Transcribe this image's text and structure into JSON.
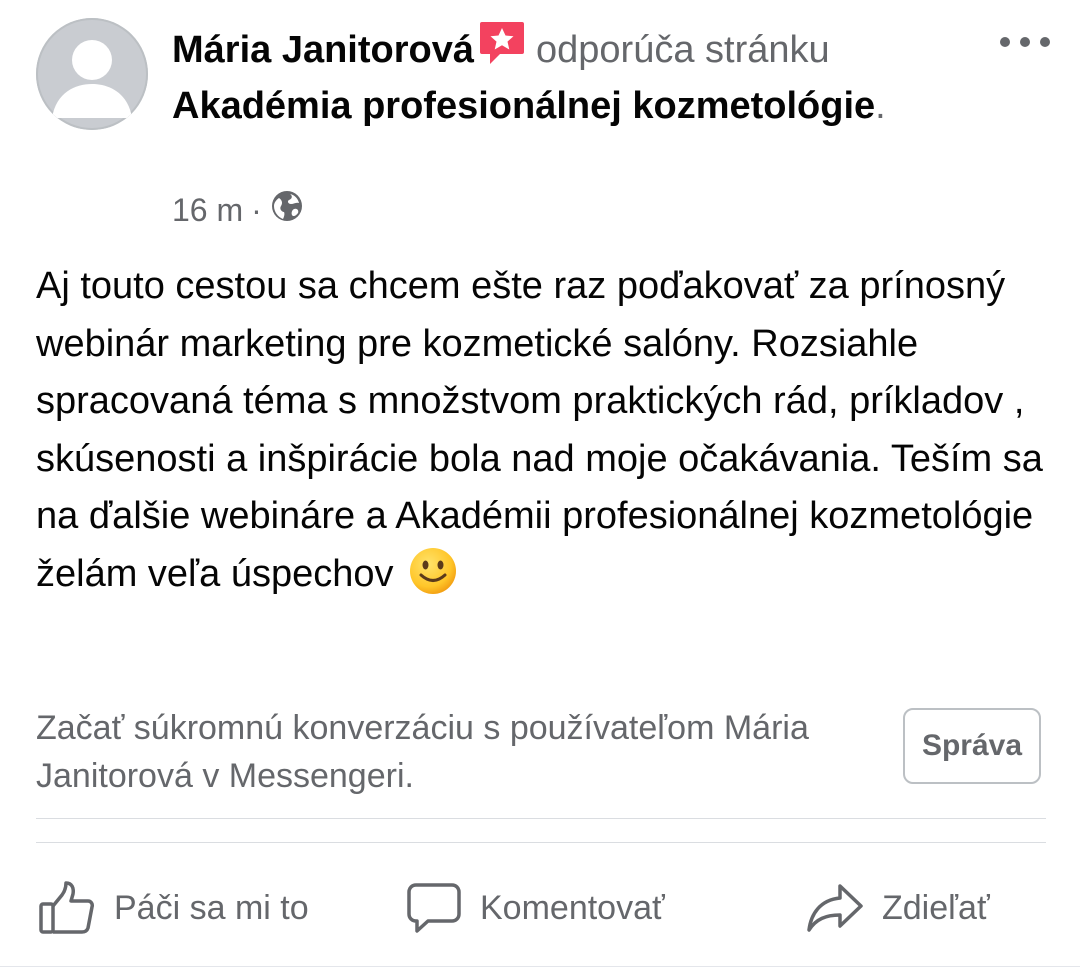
{
  "post": {
    "author": "Mária Janitorová",
    "action_text": "odporúča stránku",
    "page_name": "Akadémia profesionálnej kozmetológie",
    "page_suffix": ".",
    "time": "16 m",
    "meta_separator": "·",
    "privacy_icon": "globe-icon",
    "recommend_icon": "recommend-badge-icon",
    "body": "Aj touto cestou sa chcem ešte raz poďakovať za prínosný webinár marketing pre kozmetické salóny. Rozsiahle spracovaná téma s množstvom praktických rád, príkladov , skúsenosti a inšpirácie bola nad moje očakávania. Teším sa na ďalšie webináre a Akadémii profesionálnej kozmetológie želám veľa úspechov",
    "emoji": "slightly-smiling-face"
  },
  "messenger": {
    "prompt": "Začať súkromnú konverzáciu s používateľom Mária Janitorová v Messengeri.",
    "button_label": "Správa"
  },
  "actions": [
    {
      "label": "Páči sa mi to",
      "icon": "thumbs-up-icon"
    },
    {
      "label": "Komentovať",
      "icon": "comment-icon"
    },
    {
      "label": "Zdieľať",
      "icon": "share-icon"
    }
  ],
  "colors": {
    "text_primary": "#050505",
    "text_secondary": "#65676b",
    "recommend_badge": "#f3425f",
    "divider": "#dadde1"
  }
}
